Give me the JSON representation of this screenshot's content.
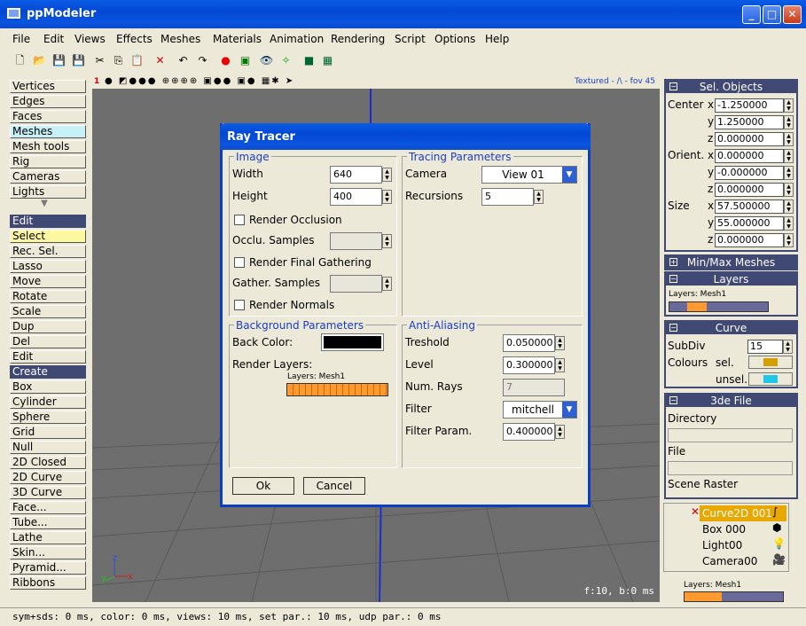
{
  "app": {
    "title": "ppModeler"
  },
  "menu": [
    "File",
    "Edit",
    "Views",
    "Effects",
    "Meshes",
    "Materials",
    "Animation",
    "Rendering",
    "Script",
    "Options",
    "Help"
  ],
  "left_tools": {
    "modes": [
      "Vertices",
      "Edges",
      "Faces",
      "Meshes",
      "Mesh tools",
      "Rig",
      "Cameras",
      "Lights"
    ],
    "edit_header": "Edit",
    "edit_items": [
      "Select",
      "Rec. Sel.",
      "Lasso",
      "Move",
      "Rotate",
      "Scale",
      "Dup",
      "Del",
      "Edit"
    ],
    "create_header": "Create",
    "create_items": [
      "Box",
      "Cylinder",
      "Sphere",
      "Grid",
      "Null",
      "2D Closed",
      "2D Curve",
      "3D Curve",
      "Face...",
      "Tube...",
      "Lathe",
      "Skin...",
      "Pyramid...",
      "Ribbons"
    ]
  },
  "viewport": {
    "label": "1",
    "info": "Textured - /\\ - fov 45",
    "fps": "f:10, b:0 ms"
  },
  "right_panel": {
    "sel_objects": {
      "title": "Sel. Objects",
      "center_label": "Center",
      "orient_label": "Orient.",
      "size_label": "Size",
      "center": [
        "-1.250000",
        "1.250000",
        "0.000000"
      ],
      "orient": [
        "0.000000",
        "-0.000000",
        "0.000000"
      ],
      "size": [
        "57.500000",
        "55.000000",
        "0.000000"
      ],
      "axes": [
        "x",
        "y",
        "z"
      ]
    },
    "minmax_title": "Min/Max Meshes",
    "layers_title": "Layers",
    "layers_label": "Layers: Mesh1",
    "curve": {
      "title": "Curve",
      "subdiv_label": "SubDiv",
      "subdiv": "15",
      "colours_label": "Colours",
      "sel_label": "sel.",
      "unsel_label": "unsel.",
      "sel_color": "#d4a000",
      "unsel_color": "#20c8e8"
    },
    "file3de": {
      "title": "3de File",
      "directory_label": "Directory",
      "file_label": "File",
      "raster_label": "Scene Raster"
    },
    "objects": [
      "Curve2D 001",
      "Box 000",
      "Light00",
      "Camera00"
    ],
    "bottom_layers_label": "Layers: Mesh1"
  },
  "status": "sym+sds: 0 ms, color: 0 ms, views: 10 ms, set par.: 10 ms, udp par.: 0 ms",
  "dialog": {
    "title": "Ray Tracer",
    "image": {
      "title": "Image",
      "width_label": "Width",
      "width": "640",
      "height_label": "Height",
      "height": "400",
      "occlusion_label": "Render Occlusion",
      "occlu_samples_label": "Occlu. Samples",
      "final_gathering_label": "Render Final Gathering",
      "gather_samples_label": "Gather. Samples",
      "normals_label": "Render Normals"
    },
    "tracing": {
      "title": "Tracing Parameters",
      "camera_label": "Camera",
      "camera": "View 01",
      "recursions_label": "Recursions",
      "recursions": "5"
    },
    "background": {
      "title": "Background Parameters",
      "back_color_label": "Back Color:",
      "back_color": "#000000",
      "render_layers_label": "Render Layers:",
      "layers_label": "Layers: Mesh1"
    },
    "antialiasing": {
      "title": "Anti-Aliasing",
      "treshold_label": "Treshold",
      "treshold": "0.050000",
      "level_label": "Level",
      "level": "0.300000",
      "num_rays_label": "Num. Rays",
      "num_rays": "7",
      "filter_label": "Filter",
      "filter": "mitchell",
      "filter_param_label": "Filter Param.",
      "filter_param": "0.400000"
    },
    "ok_label": "Ok",
    "cancel_label": "Cancel"
  }
}
